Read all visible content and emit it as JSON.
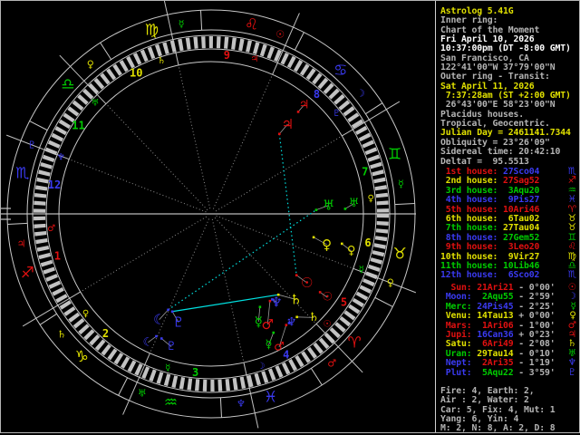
{
  "app_title": "Astrolog 5.41G",
  "colors": {
    "red": "#e01010",
    "yellow": "#e0e000",
    "green": "#00cc00",
    "blue": "#3a3af0",
    "cyan": "#00e0e0",
    "white": "#ffffff",
    "gray": "#b4b4b4",
    "dim": "#8c8c8c",
    "ring": "#c8c8c8",
    "background": "#000000"
  },
  "panel": {
    "header_lines": [
      {
        "text": "Astrolog 5.41G",
        "color": "yellow"
      },
      {
        "text": "Inner ring:",
        "color": "gray"
      },
      {
        "text": "Chart of the Moment",
        "color": "gray"
      },
      {
        "text": "Fri April 10, 2026",
        "color": "white"
      },
      {
        "text": "10:37:00pm (DT -8:00 GMT)",
        "color": "white"
      },
      {
        "text": "San Francisco, CA",
        "color": "gray"
      },
      {
        "text": "122°41'00\"W 37°79'00\"N",
        "color": "gray"
      },
      {
        "text": "Outer ring - Transit:",
        "color": "gray"
      },
      {
        "text": "Sat April 11, 2026",
        "color": "yellow"
      },
      {
        "text": " 7:37:28am (ST +2:00 GMT)",
        "color": "yellow"
      },
      {
        "text": " 26°43'00\"E 58°23'00\"N",
        "color": "gray"
      },
      {
        "text": "Placidus houses.",
        "color": "gray"
      },
      {
        "text": "Tropical, Geocentric.",
        "color": "gray"
      },
      {
        "text": "Julian Day = 2461141.7344",
        "color": "yellow"
      },
      {
        "text": "Obliquity = 23°26'09\"",
        "color": "gray"
      },
      {
        "text": "Sidereal time: 20:42:10",
        "color": "gray"
      },
      {
        "text": "DeltaT =  95.5513",
        "color": "gray"
      }
    ],
    "houses": [
      {
        "label": "1st house:",
        "value": "27Sco04",
        "label_color": "red",
        "value_color": "blue",
        "glyph": "♏"
      },
      {
        "label": "2nd house:",
        "value": "27Sag52",
        "label_color": "yellow",
        "value_color": "red",
        "glyph": "♐"
      },
      {
        "label": "3rd house:",
        "value": "3Aqu20",
        "label_color": "green",
        "value_color": "green",
        "glyph": "♒"
      },
      {
        "label": "4th house:",
        "value": "9Pis27",
        "label_color": "blue",
        "value_color": "blue",
        "glyph": "♓"
      },
      {
        "label": "5th house:",
        "value": "10Ari46",
        "label_color": "red",
        "value_color": "red",
        "glyph": "♈"
      },
      {
        "label": "6th house:",
        "value": "6Tau02",
        "label_color": "yellow",
        "value_color": "yellow",
        "glyph": "♉"
      },
      {
        "label": "7th house:",
        "value": "27Tau04",
        "label_color": "green",
        "value_color": "yellow",
        "glyph": "♉"
      },
      {
        "label": "8th house:",
        "value": "27Gem52",
        "label_color": "blue",
        "value_color": "green",
        "glyph": "♊"
      },
      {
        "label": "9th house:",
        "value": "3Leo20",
        "label_color": "red",
        "value_color": "red",
        "glyph": "♌"
      },
      {
        "label": "10th house:",
        "value": "9Vir27",
        "label_color": "yellow",
        "value_color": "yellow",
        "glyph": "♍"
      },
      {
        "label": "11th house:",
        "value": "10Lib46",
        "label_color": "green",
        "value_color": "green",
        "glyph": "♎"
      },
      {
        "label": "12th house:",
        "value": "6Sco02",
        "label_color": "blue",
        "value_color": "blue",
        "glyph": "♏"
      }
    ],
    "planets": [
      {
        "label": "Sun:",
        "value": "21Ari21",
        "velocity": "- 0°00'",
        "label_color": "red",
        "value_color": "red",
        "glyph": "☉"
      },
      {
        "label": "Moon:",
        "value": "2Aqu55",
        "velocity": "- 2°59'",
        "label_color": "blue",
        "value_color": "green",
        "glyph": "☽"
      },
      {
        "label": "Merc:",
        "value": "24Pis45",
        "velocity": "- 2°25'",
        "label_color": "green",
        "value_color": "blue",
        "glyph": "☿"
      },
      {
        "label": "Venu:",
        "value": "14Tau13",
        "velocity": "+ 0°00'",
        "label_color": "yellow",
        "value_color": "yellow",
        "glyph": "♀"
      },
      {
        "label": "Mars:",
        "value": "1Ari06",
        "velocity": "- 1°00'",
        "label_color": "red",
        "value_color": "red",
        "glyph": "♂"
      },
      {
        "label": "Jupi:",
        "value": "16Can36",
        "velocity": "+ 0°23'",
        "label_color": "red",
        "value_color": "blue",
        "glyph": "♃"
      },
      {
        "label": "Satu:",
        "value": "6Ari49",
        "velocity": "- 2°08'",
        "label_color": "yellow",
        "value_color": "red",
        "glyph": "♄"
      },
      {
        "label": "Uran:",
        "value": "29Tau14",
        "velocity": "- 0°10'",
        "label_color": "green",
        "value_color": "yellow",
        "glyph": "♅"
      },
      {
        "label": "Nept:",
        "value": "2Ari35",
        "velocity": "- 1°19'",
        "label_color": "blue",
        "value_color": "red",
        "glyph": "♆"
      },
      {
        "label": "Plut:",
        "value": "5Aqu22",
        "velocity": "- 3°59'",
        "label_color": "blue",
        "value_color": "green",
        "glyph": "♇"
      }
    ],
    "totals": [
      "Fire: 4, Earth: 2,",
      "Air : 2, Water: 2",
      "Car: 5, Fix: 4, Mut: 1",
      "Yang: 6, Yin: 4",
      "M: 2, N: 8, A: 2, D: 8"
    ]
  },
  "wheel": {
    "descendant_deg": 57.07,
    "signs": [
      {
        "name": "aries",
        "glyph": "♈",
        "color": "red",
        "start": 0,
        "ruler_glyph": "♂",
        "ruler_color": "red"
      },
      {
        "name": "taurus",
        "glyph": "♉",
        "color": "yellow",
        "start": 30,
        "ruler_glyph": "♀",
        "ruler_color": "yellow"
      },
      {
        "name": "gemini",
        "glyph": "♊",
        "color": "green",
        "start": 60,
        "ruler_glyph": "☿",
        "ruler_color": "green"
      },
      {
        "name": "cancer",
        "glyph": "♋",
        "color": "blue",
        "start": 90,
        "ruler_glyph": "☽",
        "ruler_color": "blue"
      },
      {
        "name": "leo",
        "glyph": "♌",
        "color": "red",
        "start": 120,
        "ruler_glyph": "☉",
        "ruler_color": "red"
      },
      {
        "name": "virgo",
        "glyph": "♍",
        "color": "yellow",
        "start": 150,
        "ruler_glyph": "☿",
        "ruler_color": "green"
      },
      {
        "name": "libra",
        "glyph": "♎",
        "color": "green",
        "start": 180,
        "ruler_glyph": "♀",
        "ruler_color": "yellow"
      },
      {
        "name": "scorpio",
        "glyph": "♏",
        "color": "blue",
        "start": 210,
        "ruler_glyph": "♇",
        "ruler_color": "blue"
      },
      {
        "name": "sagittarius",
        "glyph": "♐",
        "color": "red",
        "start": 240,
        "ruler_glyph": "♃",
        "ruler_color": "red"
      },
      {
        "name": "capricorn",
        "glyph": "♑",
        "color": "yellow",
        "start": 270,
        "ruler_glyph": "♄",
        "ruler_color": "yellow"
      },
      {
        "name": "aquarius",
        "glyph": "♒",
        "color": "green",
        "start": 300,
        "ruler_glyph": "♅",
        "ruler_color": "green"
      },
      {
        "name": "pisces",
        "glyph": "♓",
        "color": "blue",
        "start": 330,
        "ruler_glyph": "♆",
        "ruler_color": "blue"
      }
    ],
    "house_cusps": [
      {
        "num": 1,
        "lambda": 237.07,
        "color": "red",
        "ruler_glyph": "♂",
        "ruler_color": "red"
      },
      {
        "num": 2,
        "lambda": 267.87,
        "color": "yellow",
        "ruler_glyph": "♀",
        "ruler_color": "yellow"
      },
      {
        "num": 3,
        "lambda": 303.33,
        "color": "green",
        "ruler_glyph": "☿",
        "ruler_color": "green"
      },
      {
        "num": 4,
        "lambda": 339.45,
        "color": "blue",
        "ruler_glyph": "☽",
        "ruler_color": "blue"
      },
      {
        "num": 5,
        "lambda": 10.77,
        "color": "red",
        "ruler_glyph": "☉",
        "ruler_color": "red"
      },
      {
        "num": 6,
        "lambda": 36.03,
        "color": "yellow",
        "ruler_glyph": "☿",
        "ruler_color": "green"
      },
      {
        "num": 7,
        "lambda": 57.07,
        "color": "green",
        "ruler_glyph": "♀",
        "ruler_color": "yellow"
      },
      {
        "num": 8,
        "lambda": 87.87,
        "color": "blue",
        "ruler_glyph": "♇",
        "ruler_color": "blue"
      },
      {
        "num": 9,
        "lambda": 123.33,
        "color": "red",
        "ruler_glyph": "♃",
        "ruler_color": "red"
      },
      {
        "num": 10,
        "lambda": 159.45,
        "color": "yellow",
        "ruler_glyph": "♄",
        "ruler_color": "yellow"
      },
      {
        "num": 11,
        "lambda": 190.77,
        "color": "green",
        "ruler_glyph": "♅",
        "ruler_color": "green"
      },
      {
        "num": 12,
        "lambda": 216.03,
        "color": "blue",
        "ruler_glyph": "♆",
        "ruler_color": "blue"
      }
    ],
    "planets": [
      {
        "name": "sun",
        "glyph": "☉",
        "color": "red",
        "lambda": 21.35
      },
      {
        "name": "moon",
        "glyph": "☾",
        "color": "blue",
        "lambda": 302.92
      },
      {
        "name": "mercury",
        "glyph": "☿",
        "color": "green",
        "lambda": 354.75
      },
      {
        "name": "venus",
        "glyph": "♀",
        "color": "yellow",
        "lambda": 44.22
      },
      {
        "name": "mars",
        "glyph": "♂",
        "color": "red",
        "lambda": 1.1
      },
      {
        "name": "jupiter",
        "glyph": "♃",
        "color": "red",
        "lambda": 106.6
      },
      {
        "name": "saturn",
        "glyph": "♄",
        "color": "yellow",
        "lambda": 6.82
      },
      {
        "name": "uranus",
        "glyph": "♅",
        "color": "green",
        "lambda": 59.23
      },
      {
        "name": "neptune",
        "glyph": "♆",
        "color": "blue",
        "lambda": 2.58
      },
      {
        "name": "pluto",
        "glyph": "♇",
        "color": "blue",
        "lambda": 305.37
      }
    ],
    "aspect_lines": [
      {
        "from": "pluto",
        "to": "saturn",
        "style": "solid",
        "color": "cyan"
      },
      {
        "from": "moon",
        "to": "uranus",
        "style": "dotted",
        "color": "cyan"
      },
      {
        "from": "jupiter",
        "to": "sun",
        "style": "dotted",
        "color": "cyan"
      }
    ]
  }
}
